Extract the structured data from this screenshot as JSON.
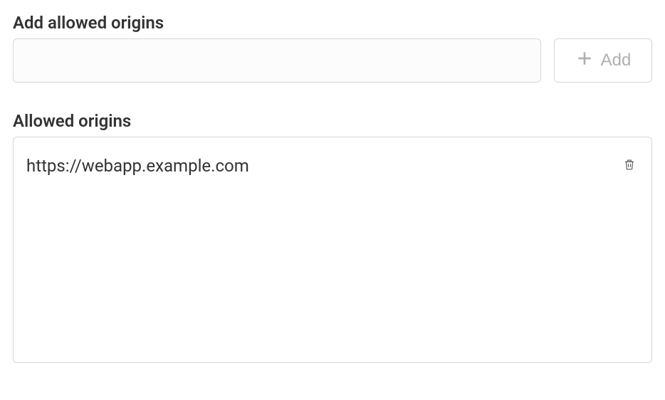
{
  "add_section": {
    "label": "Add allowed origins",
    "input_value": "",
    "input_placeholder": "",
    "button_label": "Add"
  },
  "list_section": {
    "label": "Allowed origins",
    "items": [
      {
        "url": "https://webapp.example.com"
      }
    ]
  }
}
